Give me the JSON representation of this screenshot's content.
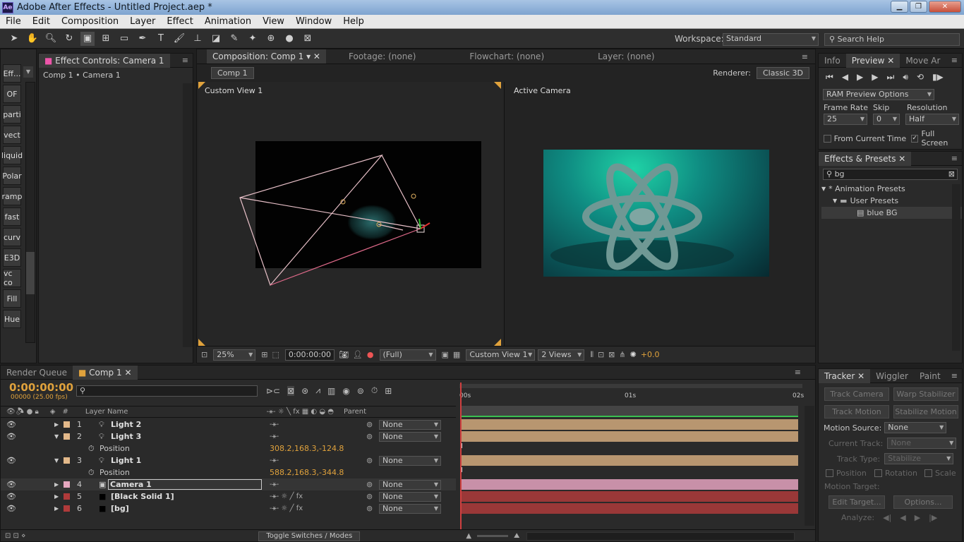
{
  "window": {
    "title": "Adobe After Effects - Untitled Project.aep *",
    "app_icon": "Ae"
  },
  "menu": [
    "File",
    "Edit",
    "Composition",
    "Layer",
    "Effect",
    "Animation",
    "View",
    "Window",
    "Help"
  ],
  "toolbar": {
    "workspace_label": "Workspace:",
    "workspace_value": "Standard",
    "search_placeholder": "Search Help"
  },
  "effect_controls": {
    "tab": "Effect Controls: Camera 1",
    "breadcrumb": "Comp 1 • Camera 1"
  },
  "sidebar_tools": [
    "Eff...",
    "OF",
    "parti",
    "vect",
    "liquid",
    "Polar",
    "ramp",
    "fast",
    "curv",
    "E3D",
    "vc co",
    "Fill",
    "Hue"
  ],
  "composition": {
    "tabs": [
      "Composition: Comp 1",
      "Footage: (none)",
      "Flowchart: (none)",
      "Layer: (none)"
    ],
    "comp_button": "Comp 1",
    "renderer_label": "Renderer:",
    "renderer_value": "Classic 3D",
    "view_left": "Custom View 1",
    "view_right": "Active Camera",
    "zoom": "25%",
    "timecode": "0:00:00:00",
    "resolution": "(Full)",
    "view_select": "Custom View 1",
    "views_count": "2 Views",
    "exposure": "+0.0"
  },
  "preview": {
    "tabs": [
      "Info",
      "Preview",
      "Move Ar"
    ],
    "ram_preview": "RAM Preview Options",
    "frame_rate_label": "Frame Rate",
    "skip_label": "Skip",
    "resolution_label": "Resolution",
    "frame_rate": "25",
    "skip": "0",
    "resolution": "Half",
    "from_current_time": "From Current Time",
    "full_screen": "Full Screen"
  },
  "effects_presets": {
    "tab": "Effects & Presets",
    "search": "bg",
    "tree": [
      "* Animation Presets",
      "User Presets",
      "blue BG"
    ]
  },
  "tracker": {
    "tabs": [
      "Tracker",
      "Wiggler",
      "Paint"
    ],
    "track_camera": "Track Camera",
    "warp_stabilizer": "Warp Stabilizer",
    "track_motion": "Track Motion",
    "stabilize_motion": "Stabilize Motion",
    "motion_source_label": "Motion Source:",
    "motion_source": "None",
    "current_track_label": "Current Track:",
    "current_track": "None",
    "track_type_label": "Track Type:",
    "track_type": "Stabilize",
    "position": "Position",
    "rotation": "Rotation",
    "scale": "Scale",
    "motion_target_label": "Motion Target:",
    "edit_target": "Edit Target...",
    "options": "Options...",
    "analyze_label": "Analyze:"
  },
  "timeline": {
    "tabs": [
      "Render Queue",
      "Comp 1"
    ],
    "timecode": "0:00:00:00",
    "fps": "00000 (25.00 fps)",
    "search_placeholder": "",
    "col_num": "#",
    "col_layer_name": "Layer Name",
    "col_parent": "Parent",
    "ruler": [
      "00s",
      "01s",
      "02s"
    ],
    "toggle_label": "Toggle Switches / Modes",
    "layers": [
      {
        "num": "1",
        "name": "Light 2",
        "type": "light",
        "color": "#e3b98a",
        "parent": "None",
        "expanded": false,
        "bar": "#b89670"
      },
      {
        "num": "2",
        "name": "Light 3",
        "type": "light",
        "color": "#e3b98a",
        "parent": "None",
        "expanded": true,
        "bar": "#b89670",
        "prop": "Position",
        "prop_value": "308.2,168.3,-124.8"
      },
      {
        "num": "3",
        "name": "Light 1",
        "type": "light",
        "color": "#e3b98a",
        "parent": "None",
        "expanded": true,
        "bar": "#b89670",
        "prop": "Position",
        "prop_value": "588.2,168.3,-344.8"
      },
      {
        "num": "4",
        "name": "Camera 1",
        "type": "camera",
        "color": "#e7a8c0",
        "parent": "None",
        "expanded": false,
        "bar": "#c890a8"
      },
      {
        "num": "5",
        "name": "[Black Solid 1]",
        "type": "solid",
        "color": "#b03a3a",
        "parent": "None",
        "expanded": false,
        "bar": "#9a3838"
      },
      {
        "num": "6",
        "name": "[bg]",
        "type": "solid",
        "color": "#b03a3a",
        "parent": "None",
        "expanded": false,
        "bar": "#9a3838"
      }
    ]
  }
}
